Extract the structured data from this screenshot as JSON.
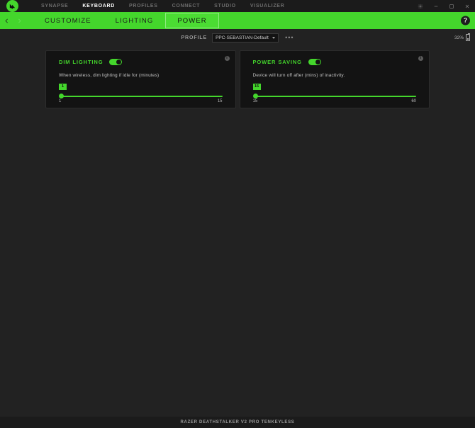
{
  "titlebar": {
    "logo_icon": "razer-logo-icon",
    "nav": [
      {
        "label": "SYNAPSE",
        "active": false
      },
      {
        "label": "KEYBOARD",
        "active": true
      },
      {
        "label": "PROFILES",
        "active": false
      },
      {
        "label": "CONNECT",
        "active": false
      },
      {
        "label": "STUDIO",
        "active": false
      },
      {
        "label": "VISUALIZER",
        "active": false
      }
    ],
    "window_controls": [
      {
        "name": "settings-gear-icon"
      },
      {
        "name": "minimize-icon"
      },
      {
        "name": "maximize-icon"
      },
      {
        "name": "close-icon"
      }
    ]
  },
  "tabbar": {
    "back_icon": "chevron-left-icon",
    "forward_icon": "chevron-right-icon",
    "tabs": [
      {
        "label": "CUSTOMIZE",
        "active": false
      },
      {
        "label": "LIGHTING",
        "active": false
      },
      {
        "label": "POWER",
        "active": true
      }
    ],
    "help_label": "?",
    "accent_color": "#44d62c"
  },
  "profilebar": {
    "label": "PROFILE",
    "selected_profile": "PPC-SEBASTIAN-Default",
    "options_label": "•••",
    "battery_percent": "32%"
  },
  "cards": [
    {
      "title": "DIM LIGHTING",
      "toggle_on": true,
      "info_label": "i",
      "description": "When wireless, dim lighting if idle for (minutes)",
      "slider": {
        "value": "1",
        "min_label": "1",
        "max_label": "15",
        "fill_percent": 0
      }
    },
    {
      "title": "POWER SAVING",
      "toggle_on": true,
      "info_label": "i",
      "description": "Device will turn off after (mins) of inactivity.",
      "slider": {
        "value": "15",
        "min_label": "15",
        "max_label": "60",
        "fill_percent": 0
      }
    }
  ],
  "footer": {
    "device_name": "RAZER DEATHSTALKER V2 PRO TENKEYLESS"
  }
}
